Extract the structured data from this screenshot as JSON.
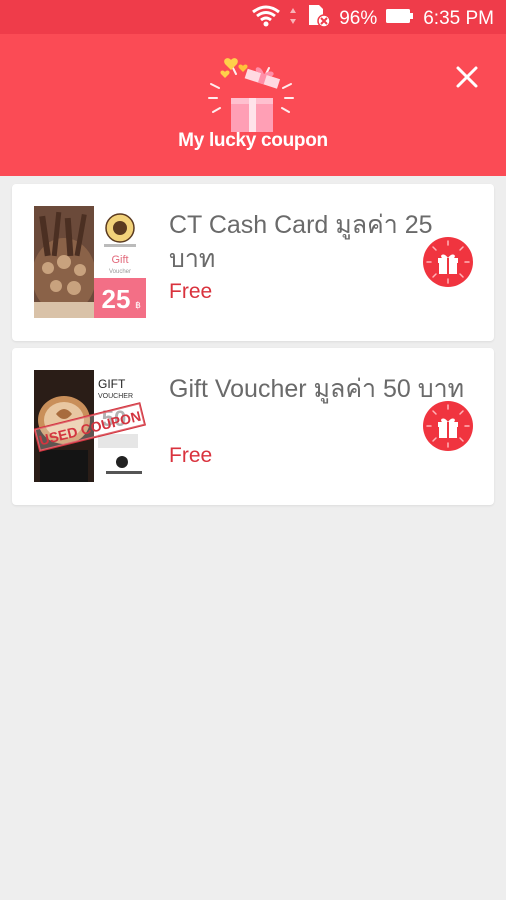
{
  "status_bar": {
    "battery_percent": "96%",
    "time": "6:35 PM",
    "icons": [
      "wifi-icon",
      "sd-card-icon",
      "battery-icon"
    ]
  },
  "header": {
    "title": "My lucky coupon",
    "background_color": "#fb4b55",
    "icons": [
      "gift-box-icon",
      "close-icon"
    ]
  },
  "coupons": [
    {
      "title": "CT Cash Card มูลค่า 25 บาท",
      "price": "Free",
      "image": {
        "text_gift": "Gift",
        "text_voucher": "Voucher",
        "amount": "25",
        "currency": "฿"
      },
      "action_icon": "gift-icon"
    },
    {
      "title": "Gift Voucher มูลค่า 50 บาท",
      "price": "Free",
      "image": {
        "text_gift": "GIFT",
        "text_voucher": "VOUCHER",
        "amount": "50",
        "stamp": "USED COUPON"
      },
      "action_icon": "gift-icon"
    }
  ],
  "colors": {
    "accent": "#f0343f",
    "price": "#d9323d"
  }
}
